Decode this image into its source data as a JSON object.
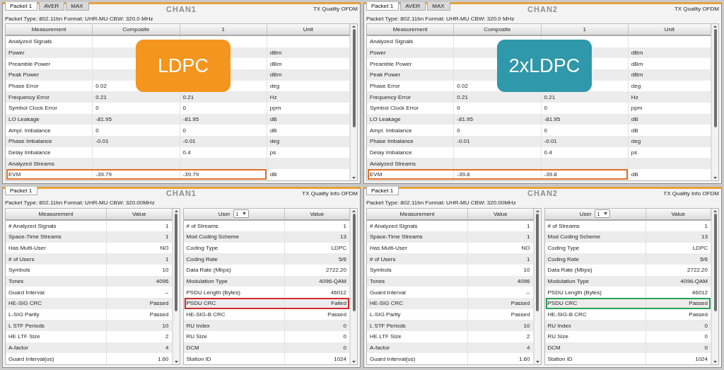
{
  "panels": [
    {
      "kind": "measurements",
      "tabs": [
        {
          "label": "Packet 1",
          "selected": true
        },
        {
          "label": "AVER",
          "selected": false
        },
        {
          "label": "MAX",
          "selected": false
        }
      ],
      "channel": "CHAN1",
      "title": "TX Quality OFDM",
      "packet_type": "Packet Type: 802.11bn Format: UHR-MU CBW: 320.0 MHz",
      "badge": {
        "label": "LDPC",
        "color": "#f4951e"
      },
      "tables": [
        {
          "columns": [
            {
              "label": "Measurement"
            },
            {
              "label": "Composite"
            },
            {
              "label": "1"
            },
            {
              "label": "Unit"
            }
          ],
          "rows": [
            {
              "cells": [
                "Analyzed Signals",
                null,
                null,
                null
              ]
            },
            {
              "cells": [
                "Power",
                null,
                null,
                "dBm"
              ]
            },
            {
              "cells": [
                "Preamble Power",
                null,
                null,
                "dBm"
              ]
            },
            {
              "cells": [
                "Peak Power",
                null,
                null,
                "dBm"
              ]
            },
            {
              "cells": [
                "Phase Error",
                "0.02",
                null,
                "deg"
              ]
            },
            {
              "cells": [
                "Frequency Error",
                "0.21",
                "0.21",
                "Hz"
              ]
            },
            {
              "cells": [
                "Symbol Clock Error",
                "0",
                "0",
                "ppm"
              ]
            },
            {
              "cells": [
                "LO Leakage",
                "-81.95",
                "-81.95",
                "dB"
              ]
            },
            {
              "cells": [
                "Ampl. Imbalance",
                "0",
                "0",
                "dB"
              ]
            },
            {
              "cells": [
                "Phase Imbalance",
                "-0.01",
                "-0.01",
                "deg"
              ]
            },
            {
              "cells": [
                "Delay Imbalance",
                null,
                "0.4",
                "ps"
              ]
            },
            {
              "cells": [
                "Analyzed Streams",
                null,
                null,
                null
              ]
            },
            {
              "cells": [
                "EVM",
                "-39.79",
                "-39.79",
                "dB"
              ],
              "color": "#e0702a"
            }
          ]
        }
      ]
    },
    {
      "kind": "measurements",
      "tabs": [
        {
          "label": "Packet 1",
          "selected": true
        },
        {
          "label": "AVER",
          "selected": false
        },
        {
          "label": "MAX",
          "selected": false
        }
      ],
      "channel": "CHAN2",
      "title": "TX Quality OFDM",
      "packet_type": "Packet Type: 802.11bn Format: UHR-MU CBW: 320.0 MHz",
      "badge": {
        "label": "2xLDPC",
        "color": "#2f98aa"
      },
      "tables": [
        {
          "columns": [
            {
              "label": "Measurement"
            },
            {
              "label": "Composite"
            },
            {
              "label": "1"
            },
            {
              "label": "Unit"
            }
          ],
          "rows": [
            {
              "cells": [
                "Analyzed Signals",
                null,
                null,
                null
              ]
            },
            {
              "cells": [
                "Power",
                null,
                null,
                "dBm"
              ]
            },
            {
              "cells": [
                "Preamble Power",
                null,
                null,
                "dBm"
              ]
            },
            {
              "cells": [
                "Peak Power",
                null,
                null,
                "dBm"
              ]
            },
            {
              "cells": [
                "Phase Error",
                "0.02",
                null,
                "deg"
              ]
            },
            {
              "cells": [
                "Frequency Error",
                "0.21",
                "0.21",
                "Hz"
              ]
            },
            {
              "cells": [
                "Symbol Clock Error",
                "0",
                "0",
                "ppm"
              ]
            },
            {
              "cells": [
                "LO Leakage",
                "-81.95",
                "-81.95",
                "dB"
              ]
            },
            {
              "cells": [
                "Ampl. Imbalance",
                "0",
                "0",
                "dB"
              ]
            },
            {
              "cells": [
                "Phase Imbalance",
                "-0.01",
                "-0.01",
                "deg"
              ]
            },
            {
              "cells": [
                "Delay Imbalance",
                null,
                "0.4",
                "ps"
              ]
            },
            {
              "cells": [
                "Analyzed Streams",
                null,
                null,
                null
              ]
            },
            {
              "cells": [
                "EVM",
                "-39.8",
                "-39.8",
                "dB"
              ],
              "color": "#e0702a"
            }
          ]
        }
      ]
    },
    {
      "kind": "info",
      "tabs": [
        {
          "label": "Packet 1",
          "selected": true
        }
      ],
      "channel": "CHAN1",
      "title": "TX Quality Info OFDM",
      "packet_type": "Packet Type: 802.11bn Format: UHR-MU CBW: 320.00MHz",
      "tables": [
        {
          "columns": [
            {
              "label": "Measurement"
            },
            {
              "label": "Value"
            }
          ],
          "rows": [
            {
              "cells": [
                "# Analyzed Signals",
                "1"
              ]
            },
            {
              "cells": [
                "Space-Time Streams",
                "1"
              ]
            },
            {
              "cells": [
                "Has Multi-User",
                "NO"
              ]
            },
            {
              "cells": [
                "# of Users",
                "1"
              ]
            },
            {
              "cells": [
                "Symbols",
                "10"
              ]
            },
            {
              "cells": [
                "Tones",
                "4096"
              ]
            },
            {
              "cells": [
                "Guard Interval",
                "--"
              ]
            },
            {
              "cells": [
                "HE-SIG CRC",
                "Passed"
              ]
            },
            {
              "cells": [
                "L-SIG Parity",
                "Passed"
              ]
            },
            {
              "cells": [
                "L STF Periods",
                "10"
              ]
            },
            {
              "cells": [
                "HE LTF Size",
                "2"
              ]
            },
            {
              "cells": [
                "A-factor",
                "4"
              ]
            },
            {
              "cells": [
                "Guard Interval(us)",
                "1.60"
              ]
            }
          ]
        },
        {
          "columns": [
            {
              "label": "User",
              "dropdown": "1"
            },
            {
              "label": "Value"
            }
          ],
          "rows": [
            {
              "cells": [
                "# of Streams",
                "1"
              ]
            },
            {
              "cells": [
                "Mod Coding Scheme",
                "13"
              ]
            },
            {
              "cells": [
                "Coding Type",
                "LDPC"
              ]
            },
            {
              "cells": [
                "Coding Rate",
                "5/6"
              ]
            },
            {
              "cells": [
                "Data Rate (Mbps)",
                "2722.20"
              ]
            },
            {
              "cells": [
                "Modulation Type",
                "4096-QAM"
              ]
            },
            {
              "cells": [
                "PSDU Length (Bytes)",
                "46012"
              ]
            },
            {
              "cells": [
                "PSDU CRC",
                "Failed"
              ],
              "color": "#d42a2a"
            },
            {
              "cells": [
                "HE-SIG-B CRC",
                "Passed"
              ]
            },
            {
              "cells": [
                "RU Index",
                "0"
              ]
            },
            {
              "cells": [
                "RU Size",
                "0"
              ]
            },
            {
              "cells": [
                "DCM",
                "0"
              ]
            },
            {
              "cells": [
                "Station ID",
                "1024"
              ]
            }
          ]
        }
      ]
    },
    {
      "kind": "info",
      "tabs": [
        {
          "label": "Packet 1",
          "selected": true
        }
      ],
      "channel": "CHAN2",
      "title": "TX Quality Info OFDM",
      "packet_type": "Packet Type: 802.11bn Format: UHR-MU CBW: 320.00MHz",
      "tables": [
        {
          "columns": [
            {
              "label": "Measurement"
            },
            {
              "label": "Value"
            }
          ],
          "rows": [
            {
              "cells": [
                "# Analyzed Signals",
                "1"
              ]
            },
            {
              "cells": [
                "Space-Time Streams",
                "1"
              ]
            },
            {
              "cells": [
                "Has Multi-User",
                "NO"
              ]
            },
            {
              "cells": [
                "# of Users",
                "1"
              ]
            },
            {
              "cells": [
                "Symbols",
                "10"
              ]
            },
            {
              "cells": [
                "Tones",
                "4096"
              ]
            },
            {
              "cells": [
                "Guard Interval",
                "--"
              ]
            },
            {
              "cells": [
                "HE-SIG CRC",
                "Passed"
              ]
            },
            {
              "cells": [
                "L-SIG Parity",
                "Passed"
              ]
            },
            {
              "cells": [
                "L STF Periods",
                "10"
              ]
            },
            {
              "cells": [
                "HE LTF Size",
                "2"
              ]
            },
            {
              "cells": [
                "A-factor",
                "4"
              ]
            },
            {
              "cells": [
                "Guard Interval(us)",
                "1.60"
              ]
            }
          ]
        },
        {
          "columns": [
            {
              "label": "User",
              "dropdown": "1"
            },
            {
              "label": "Value"
            }
          ],
          "rows": [
            {
              "cells": [
                "# of Streams",
                "1"
              ]
            },
            {
              "cells": [
                "Mod Coding Scheme",
                "13"
              ]
            },
            {
              "cells": [
                "Coding Type",
                "LDPC"
              ]
            },
            {
              "cells": [
                "Coding Rate",
                "5/6"
              ]
            },
            {
              "cells": [
                "Data Rate (Mbps)",
                "2722.20"
              ]
            },
            {
              "cells": [
                "Modulation Type",
                "4096-QAM"
              ]
            },
            {
              "cells": [
                "PSDU Length (Bytes)",
                "46012"
              ]
            },
            {
              "cells": [
                "PSDU CRC",
                "Passed"
              ],
              "color": "#2aa05a"
            },
            {
              "cells": [
                "HE-SIG-B CRC",
                "Passed"
              ]
            },
            {
              "cells": [
                "RU Index",
                "0"
              ]
            },
            {
              "cells": [
                "RU Size",
                "0"
              ]
            },
            {
              "cells": [
                "DCM",
                "0"
              ]
            },
            {
              "cells": [
                "Station ID",
                "1024"
              ]
            }
          ]
        }
      ]
    }
  ]
}
